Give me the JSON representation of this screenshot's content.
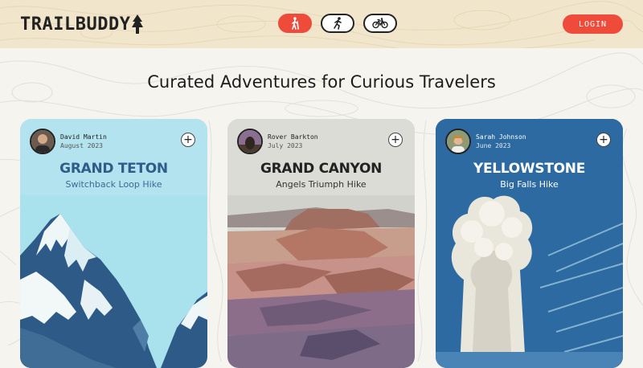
{
  "brand": {
    "name": "TRAILBUDDY",
    "accent": "#ee4b3b"
  },
  "header": {
    "modes": [
      {
        "name": "hike",
        "icon": "hiker-icon",
        "active": true
      },
      {
        "name": "run",
        "icon": "runner-icon",
        "active": false
      },
      {
        "name": "bike",
        "icon": "bike-icon",
        "active": false
      }
    ],
    "login_label": "LOGIN"
  },
  "headline": "Curated Adventures for Curious Travelers",
  "cards": [
    {
      "author": "David Martin",
      "date": "August 2023",
      "title": "GRAND TETON",
      "subtitle": "Switchback Loop Hike",
      "title_color": "#2f5d8a"
    },
    {
      "author": "Rover Barkton",
      "date": "July 2023",
      "title": "GRAND CANYON",
      "subtitle": "Angels Triumph Hike",
      "title_color": "#222222"
    },
    {
      "author": "Sarah Johnson",
      "date": "June 2023",
      "title": "YELLOWSTONE",
      "subtitle": "Big Falls Hike",
      "title_color": "#ffffff"
    }
  ]
}
